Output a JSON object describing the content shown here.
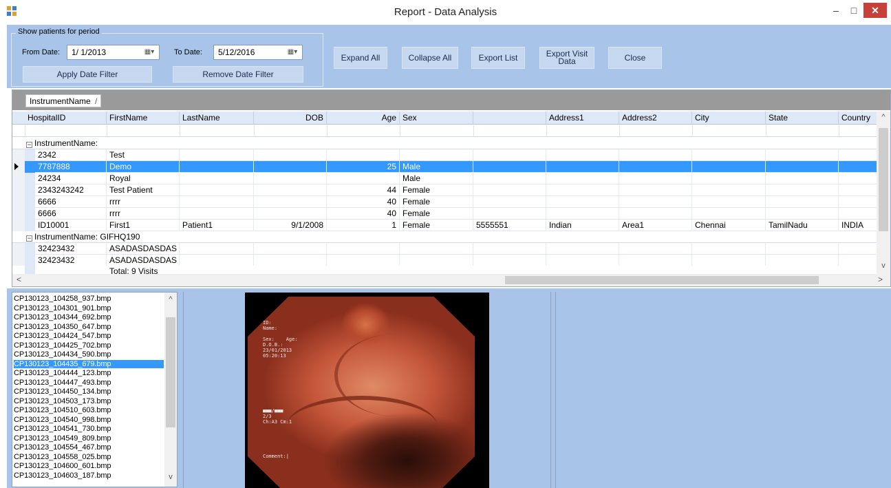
{
  "window": {
    "title": "Report - Data Analysis",
    "min_glyph": "–",
    "max_glyph": "□",
    "close_glyph": "✕"
  },
  "toolbar": {
    "group_title": "Show patients for period",
    "from_label": "From Date:",
    "from_value": "1/ 1/2013",
    "to_label": "To Date:",
    "to_value": "5/12/2016",
    "calendar_glyph": "▦▾",
    "apply_filter": "Apply Date Filter",
    "remove_filter": "Remove Date Filter",
    "expand_all": "Expand All",
    "collapse_all": "Collapse All",
    "export_list": "Export List",
    "export_visit_line1": "Export Visit",
    "export_visit_line2": "Data",
    "close": "Close"
  },
  "grid": {
    "group_chip": "InstrumentName",
    "group_chip_sort": "/",
    "columns": [
      "HospitalID",
      "FirstName",
      "LastName",
      "DOB",
      "Age",
      "Sex",
      "",
      "Address1",
      "Address2",
      "City",
      "State",
      "Country"
    ],
    "groups": [
      {
        "label": "InstrumentName:",
        "rows": [
          [
            "2342",
            "Test",
            "",
            "",
            "",
            "",
            "",
            "",
            "",
            "",
            "",
            ""
          ],
          [
            "7787888",
            "Demo",
            "",
            "",
            "25",
            "Male",
            "",
            "",
            "",
            "",
            "",
            ""
          ],
          [
            "24234",
            "Royal",
            "",
            "",
            "",
            "Male",
            "",
            "",
            "",
            "",
            "",
            ""
          ],
          [
            "2343243242",
            "Test Patient",
            "",
            "",
            "44",
            "Female",
            "",
            "",
            "",
            "",
            "",
            ""
          ],
          [
            "6666",
            "rrrr",
            "",
            "",
            "40",
            "Female",
            "",
            "",
            "",
            "",
            "",
            ""
          ],
          [
            "6666",
            "rrrr",
            "",
            "",
            "40",
            "Female",
            "",
            "",
            "",
            "",
            "",
            ""
          ],
          [
            "ID10001",
            "First1",
            "Patient1",
            "9/1/2008",
            "1",
            "Female",
            "5555551",
            "Indian",
            "Area1",
            "Chennai",
            "TamilNadu",
            "INDIA"
          ]
        ]
      },
      {
        "label": "InstrumentName: GIFHQ190",
        "rows": [
          [
            "32423432",
            "ASADASDASDAS",
            "",
            "",
            "",
            "",
            "",
            "",
            "",
            "",
            "",
            ""
          ],
          [
            "32423432",
            "ASADASDASDAS",
            "",
            "",
            "",
            "",
            "",
            "",
            "",
            "",
            "",
            ""
          ]
        ]
      }
    ],
    "total": "Total: 9 Visits",
    "collapse_glyph": "−",
    "scroll_up": "^",
    "scroll_down": "v",
    "scroll_left": "<",
    "scroll_right": ">"
  },
  "files": {
    "items": [
      "CP130123_104258_937.bmp",
      "CP130123_104301_901.bmp",
      "CP130123_104344_692.bmp",
      "CP130123_104350_647.bmp",
      "CP130123_104424_547.bmp",
      "CP130123_104425_702.bmp",
      "CP130123_104434_590.bmp",
      "CP130123_104435_679.bmp",
      "CP130123_104444_123.bmp",
      "CP130123_104447_493.bmp",
      "CP130123_104450_134.bmp",
      "CP130123_104503_173.bmp",
      "CP130123_104510_603.bmp",
      "CP130123_104540_998.bmp",
      "CP130123_104541_730.bmp",
      "CP130123_104549_809.bmp",
      "CP130123_104554_467.bmp",
      "CP130123_104558_025.bmp",
      "CP130123_104600_601.bmp",
      "CP130123_104603_187.bmp"
    ],
    "selected_index": 7,
    "scroll_up": "^",
    "scroll_down": "v"
  },
  "image_overlay": {
    "top": "ID:\nName:\n\nSex:    Age:\nD.O.B.:\n23/01/2013\n05:20:13",
    "bottom": "■■■/■■■\n2/3\nCh:A3 Cm:1",
    "comment": "Comment:|"
  },
  "colors": {
    "panel": "#a8c4e8",
    "selection": "#3399ff",
    "close_button": "#c7413a"
  }
}
